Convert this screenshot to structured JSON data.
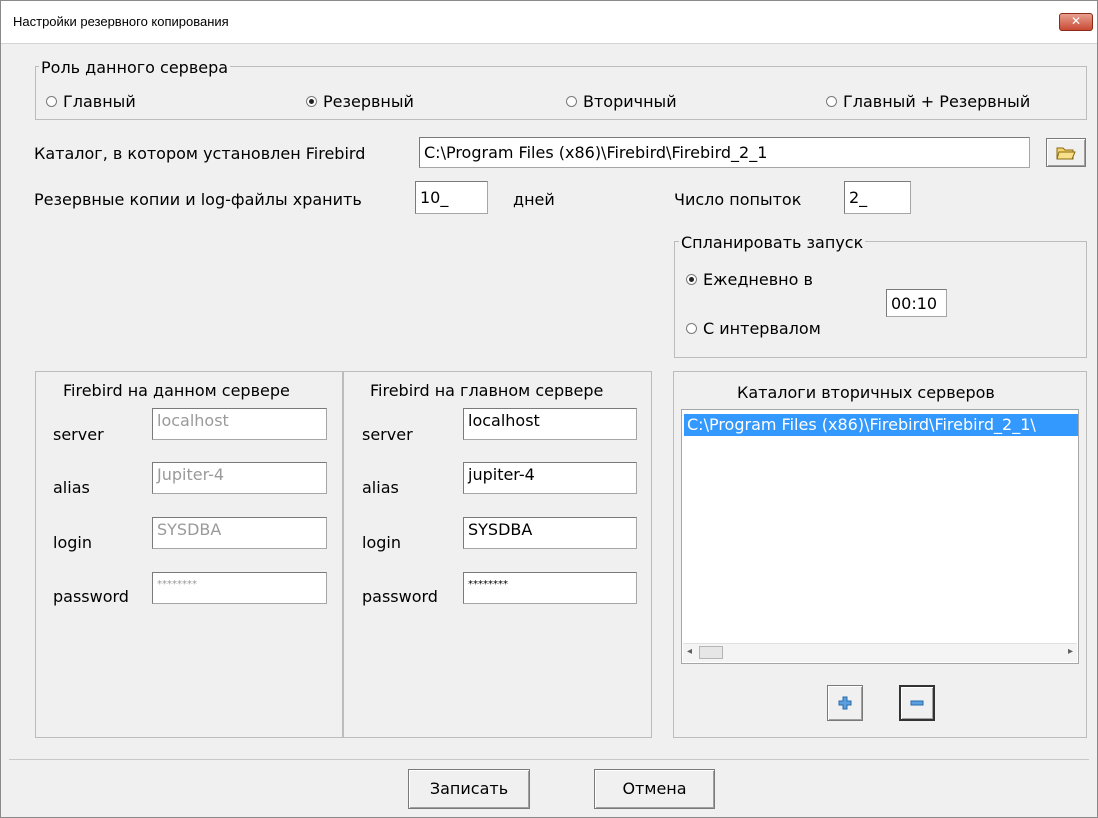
{
  "window": {
    "title": "Настройки резервного копирования",
    "close_glyph": "✕"
  },
  "role": {
    "legend": "Роль данного сервера",
    "options": [
      {
        "label": "Главный",
        "selected": false
      },
      {
        "label": "Резервный",
        "selected": true
      },
      {
        "label": "Вторичный",
        "selected": false
      },
      {
        "label": "Главный + Резервный",
        "selected": false
      }
    ]
  },
  "firebird_dir": {
    "label": "Каталог, в котором установлен Firebird",
    "value": "C:\\Program Files (x86)\\Firebird\\Firebird_2_1"
  },
  "retention": {
    "label": "Резервные копии и log-файлы хранить",
    "value": "10_",
    "unit": "дней"
  },
  "attempts": {
    "label": "Число попыток",
    "value": "2_"
  },
  "schedule": {
    "legend": "Спланировать запуск",
    "daily_label": "Ежедневно в",
    "interval_label": "С интервалом",
    "time": "00:10"
  },
  "local_fb": {
    "title": "Firebird на данном сервере",
    "fields": [
      {
        "label": "server",
        "value": "localhost"
      },
      {
        "label": "alias",
        "value": "Jupiter-4"
      },
      {
        "label": "login",
        "value": "SYSDBA"
      },
      {
        "label": "password",
        "value": "********"
      }
    ]
  },
  "main_fb": {
    "title": "Firebird на главном сервере",
    "fields": [
      {
        "label": "server",
        "value": "localhost"
      },
      {
        "label": "alias",
        "value": "jupiter-4"
      },
      {
        "label": "login",
        "value": "SYSDBA"
      },
      {
        "label": "password",
        "value": "********"
      }
    ]
  },
  "secondary": {
    "title": "Каталоги вторичных серверов",
    "items": [
      "C:\\Program Files (x86)\\Firebird\\Firebird_2_1\\"
    ]
  },
  "buttons": {
    "save": "Записать",
    "cancel": "Отмена"
  }
}
